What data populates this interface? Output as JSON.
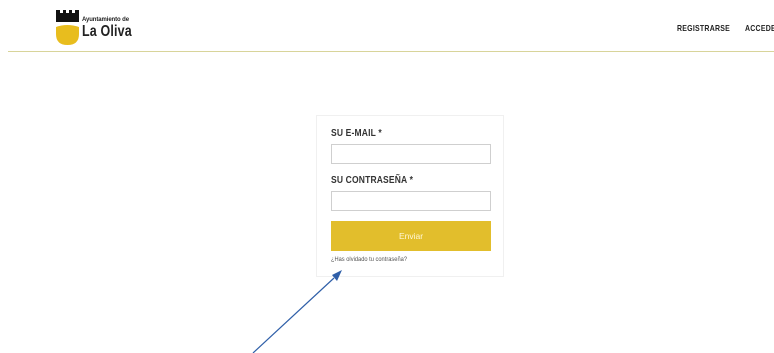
{
  "header": {
    "logo": {
      "small_text": "Ayuntamiento de",
      "big_text": "La Oliva"
    },
    "nav": {
      "register": "REGISTRARSE",
      "login": "ACCEDER"
    }
  },
  "login_form": {
    "email_label": "SU E-MAIL *",
    "email_value": "",
    "password_label": "SU CONTRASEÑA *",
    "password_value": "",
    "submit_label": "Enviar",
    "forgot_link": "¿Has olvidado tu contraseña?"
  },
  "colors": {
    "accent_yellow": "#e2be2c",
    "header_divider": "#d8d49a",
    "annotation_arrow": "#2f5fa8"
  }
}
